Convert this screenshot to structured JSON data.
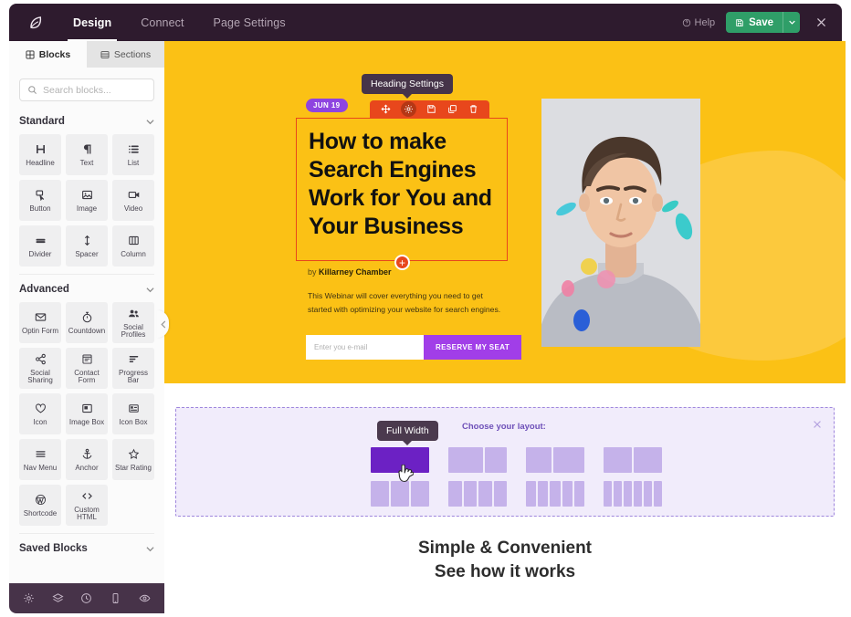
{
  "topbar": {
    "logo_icon": "leaf-logo-icon",
    "tabs": [
      {
        "label": "Design",
        "active": true
      },
      {
        "label": "Connect",
        "active": false
      },
      {
        "label": "Page Settings",
        "active": false
      }
    ],
    "help_label": "Help",
    "help_icon": "question-circle-icon",
    "save_label": "Save",
    "save_icon": "floppy-disk-icon",
    "save_caret_icon": "chevron-down-icon",
    "close_icon": "close-icon",
    "save_color": "#2f9e68",
    "bar_color": "#2e1b2e"
  },
  "sidebar": {
    "tabs": [
      {
        "label": "Blocks",
        "icon": "blocks-grid-icon",
        "active": true
      },
      {
        "label": "Sections",
        "icon": "sections-icon",
        "active": false
      }
    ],
    "search": {
      "placeholder": "Search blocks...",
      "value": "",
      "icon": "search-icon"
    },
    "groups": [
      {
        "title": "Standard",
        "chevron_icon": "chevron-down-icon",
        "blocks": [
          {
            "label": "Headline",
            "icon": "headline-h-icon"
          },
          {
            "label": "Text",
            "icon": "paragraph-pilcrow-icon"
          },
          {
            "label": "List",
            "icon": "list-icon"
          },
          {
            "label": "Button",
            "icon": "button-click-icon"
          },
          {
            "label": "Image",
            "icon": "image-icon"
          },
          {
            "label": "Video",
            "icon": "video-camera-icon"
          },
          {
            "label": "Divider",
            "icon": "divider-icon"
          },
          {
            "label": "Spacer",
            "icon": "spacer-arrows-icon"
          },
          {
            "label": "Column",
            "icon": "column-icon"
          }
        ]
      },
      {
        "title": "Advanced",
        "chevron_icon": "chevron-down-icon",
        "blocks": [
          {
            "label": "Optin Form",
            "icon": "envelope-icon"
          },
          {
            "label": "Countdown",
            "icon": "stopwatch-icon"
          },
          {
            "label": "Social Profiles",
            "icon": "users-group-icon"
          },
          {
            "label": "Social Sharing",
            "icon": "share-nodes-icon"
          },
          {
            "label": "Contact Form",
            "icon": "form-window-icon"
          },
          {
            "label": "Progress Bar",
            "icon": "progress-bars-icon"
          },
          {
            "label": "Icon",
            "icon": "heart-icon"
          },
          {
            "label": "Image Box",
            "icon": "image-box-icon"
          },
          {
            "label": "Icon Box",
            "icon": "icon-box-icon"
          },
          {
            "label": "Nav Menu",
            "icon": "hamburger-menu-icon"
          },
          {
            "label": "Anchor",
            "icon": "anchor-icon"
          },
          {
            "label": "Star Rating",
            "icon": "star-icon"
          },
          {
            "label": "Shortcode",
            "icon": "wordpress-icon"
          },
          {
            "label": "Custom HTML",
            "icon": "code-brackets-icon"
          }
        ]
      },
      {
        "title": "Saved Blocks",
        "chevron_icon": "chevron-down-icon",
        "blocks": []
      }
    ],
    "footer_icons": [
      "gear-icon",
      "layers-icon",
      "history-clock-icon",
      "mobile-device-icon",
      "eye-preview-icon"
    ],
    "collapse_icon": "chevron-left-icon"
  },
  "canvas": {
    "hero": {
      "background_color": "#fbc115",
      "heading_tooltip": "Heading Settings",
      "date_badge": "JUN 19",
      "element_toolbar": [
        {
          "icon": "move-arrows-icon",
          "active": false
        },
        {
          "icon": "gear-icon",
          "active": true
        },
        {
          "icon": "save-block-icon",
          "active": false
        },
        {
          "icon": "duplicate-icon",
          "active": false
        },
        {
          "icon": "trash-icon",
          "active": false
        }
      ],
      "heading": "How to make Search Engines Work for You and Your Business",
      "add_block_icon": "plus-circle-icon",
      "byline_prefix": "by ",
      "byline_author": "Killarney Chamber",
      "description": "This Webinar will cover everything you need to get started with optimizing your website for search engines.",
      "email_placeholder": "Enter you e-mail",
      "email_value": "",
      "cta_label": "RESERVE MY SEAT",
      "cta_color": "#a13ee8",
      "photo_alt": "portrait-photo"
    },
    "layout_picker": {
      "tooltip": "Full Width",
      "title": "Choose your layout:",
      "close_icon": "close-icon",
      "accent_color": "#6c21c4",
      "options": [
        {
          "columns": 1,
          "selected": true
        },
        {
          "columns": 2,
          "selected": false
        },
        {
          "columns": 2,
          "selected": false
        },
        {
          "columns": 2,
          "selected": false
        },
        {
          "columns": 3,
          "selected": false
        },
        {
          "columns": 4,
          "selected": false
        },
        {
          "columns": 5,
          "selected": false
        },
        {
          "columns": 6,
          "selected": false
        }
      ],
      "cursor_icon": "pointer-hand-cursor-icon"
    },
    "bottom_heading_line1": "Simple & Convenient",
    "bottom_heading_line2": "See how it works"
  }
}
